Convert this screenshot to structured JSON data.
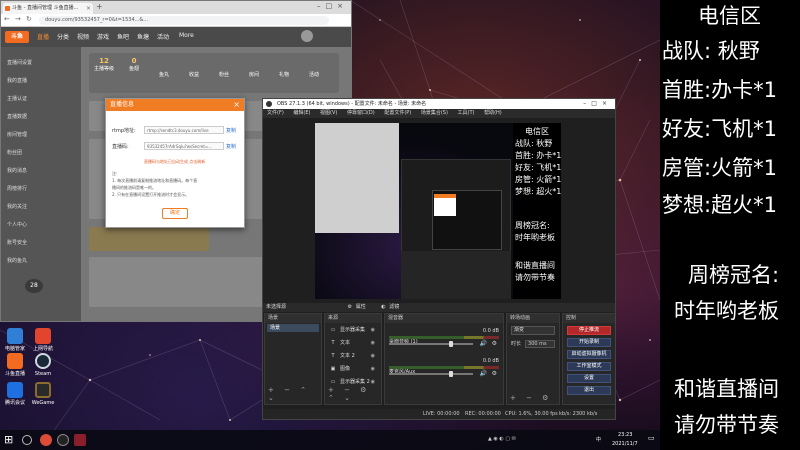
{
  "overlay": {
    "lines": [
      "电信区",
      "战队:   秋野",
      "首胜:办卡*1",
      "好友:飞机*1",
      "房管:火箭*1",
      "梦想:超火*1",
      "周榜冠名:",
      "时年哟老板",
      "和谐直播间",
      "请勿带节奏"
    ]
  },
  "browser": {
    "tab_title": "斗鱼 - 直播间管理 斗鱼直播...",
    "url": "douyu.com/93532457_r=0&t=1534...&...",
    "header_logo": "斗鱼",
    "nav": [
      "直播",
      "分类",
      "视频",
      "游戏",
      "鱼吧",
      "鱼塘",
      "活动",
      "More"
    ],
    "sidebar": [
      "直播间设置",
      "我的直播",
      "主播认证",
      "直播数据",
      "房间管理",
      "粉丝团",
      "我的消息",
      "周榜排行",
      "我的关注",
      "个人中心",
      "账号安全",
      "我的鱼丸"
    ],
    "stats": [
      {
        "v": "12",
        "l": "主播等级"
      },
      {
        "v": "0",
        "l": "鱼翅"
      },
      {
        "v": "",
        "l": "鱼丸"
      },
      {
        "v": "",
        "l": "收益"
      },
      {
        "v": "",
        "l": "粉丝"
      },
      {
        "v": "",
        "l": "房间"
      },
      {
        "v": "",
        "l": "礼物"
      },
      {
        "v": "",
        "l": "活动"
      }
    ],
    "side_badge": "28",
    "dialog": {
      "title": "直播信息",
      "close": "×",
      "rtmp_label": "rtmp地址:",
      "rtmp_value": "rtmp://sendtc3.douyu.com/live",
      "key_label": "直播码:",
      "key_value": "93532457rA4rSqlu?wsSecret=...",
      "copy": "复制",
      "warn": "直播码与地址已自动生成  点击刷新",
      "tips": [
        "注:",
        "1. 每次直播前请复制推流地址和直播码。每个直",
        "播间的推流码是唯一的。",
        "2. 只有在直播间设置打开推流时才会显示。"
      ],
      "ok": "确定"
    }
  },
  "desktop_icons": [
    {
      "label": "电脑管家",
      "color": "#2f7fd6"
    },
    {
      "label": "上网导航",
      "color": "#e2452d"
    },
    {
      "label": "斗鱼直播",
      "color": "#f26b21"
    },
    {
      "label": "Steam",
      "color": "#1b2838"
    },
    {
      "label": "腾讯会议",
      "color": "#1e6fe0"
    },
    {
      "label": "WeGame",
      "color": "#8a6d2c"
    }
  ],
  "obs": {
    "title": "OBS 27.1.3 (64 bit, windows) - 配置文件: 未命名 - 场景: 未命名",
    "menu": [
      "文件(F)",
      "编辑(E)",
      "视图(V)",
      "停靠窗口(D)",
      "配置文件(P)",
      "场景集合(S)",
      "工具(T)",
      "帮助(H)"
    ],
    "preview_text": [
      "电信区",
      "战队: 秋野",
      "首胜: 办卡*1",
      "好友: 飞机*1",
      "房管: 火箭*1",
      "梦想: 超火*1",
      "周榜冠名:",
      "时年哟老板",
      "和谐直播间",
      "请勿带节奏"
    ],
    "scene_label": "未选择源",
    "props_label": "属性",
    "filters_label": "滤镜",
    "docks": {
      "scenes": {
        "header": "场景",
        "items": [
          "场景"
        ]
      },
      "sources": {
        "header": "来源",
        "items": [
          {
            "icon": "▭",
            "name": "显示器采集"
          },
          {
            "icon": "T",
            "name": "文本"
          },
          {
            "icon": "T",
            "name": "文本 2"
          },
          {
            "icon": "▣",
            "name": "图像"
          },
          {
            "icon": "▭",
            "name": "显示器采集 2"
          }
        ]
      },
      "mixer": {
        "header": "混音器",
        "channels": [
          {
            "name": "桌面音频 (1)",
            "db": "0.0 dB",
            "level": 0.72
          },
          {
            "name": "麦克风/Aux",
            "db": "0.0 dB",
            "level": 0.72
          }
        ]
      },
      "transitions": {
        "header": "转场动画",
        "type": "渐变",
        "duration_label": "时长",
        "duration": "300 ms"
      },
      "controls": {
        "header": "控制",
        "buttons": [
          "停止推流",
          "开始录制",
          "启动虚拟摄像机",
          "工作室模式",
          "设置",
          "退出"
        ]
      }
    },
    "status": {
      "live": "LIVE: 00:00:00",
      "rec": "REC: 00:00:00",
      "cpu": "CPU: 1.6%, 30.00 fps",
      "kbps": "kb/s: 2300 kb/s"
    }
  },
  "taskbar": {
    "time": "23:23",
    "date": "2021/11/7",
    "lang": "中"
  }
}
